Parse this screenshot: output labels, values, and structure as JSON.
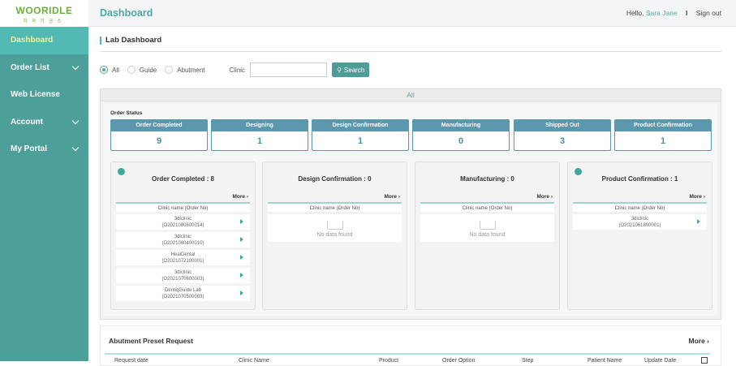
{
  "logo": {
    "name": "WOORIDLE",
    "sub": "치과기공소"
  },
  "sidebar": {
    "items": [
      {
        "label": "Dashboard"
      },
      {
        "label": "Order List"
      },
      {
        "label": "Web License"
      },
      {
        "label": "Account"
      },
      {
        "label": "My Portal"
      }
    ]
  },
  "header": {
    "title": "Dashboard",
    "hello": "Hello,",
    "user": "Sara Jane",
    "separator": "I",
    "signout": "Sign out"
  },
  "page": {
    "title": "Lab Dashboard"
  },
  "filters": {
    "options": [
      "All",
      "Guide",
      "Abutment"
    ],
    "clinic_label": "Clinic",
    "clinic_value": "",
    "search": "Search"
  },
  "panel": {
    "tab": "All",
    "order_status_label": "Order Status",
    "statuses": [
      {
        "label": "Order Completed",
        "count": "9"
      },
      {
        "label": "Designing",
        "count": "1"
      },
      {
        "label": "Design Confirmation",
        "count": "1"
      },
      {
        "label": "Manufacturing",
        "count": "0"
      },
      {
        "label": "Shipped Out",
        "count": "3"
      },
      {
        "label": "Product Confirmation",
        "count": "1"
      }
    ],
    "more": "More",
    "column_header": "Clinic name (Order No)",
    "empty": "No data found",
    "columns": [
      {
        "title": "Order Completed : 8",
        "rows": [
          {
            "clinic": "3diclinic",
            "order": "(O2021080600014)"
          },
          {
            "clinic": "3diclinic",
            "order": "(O2021080400010)"
          },
          {
            "clinic": "HealDental",
            "order": "(O2021072100001)"
          },
          {
            "clinic": "3diclinic",
            "order": "(O2021070600003)"
          },
          {
            "clinic": "DentiqGuide Lab",
            "order": "(O2021070500003)"
          }
        ]
      },
      {
        "title": "Design Confirmation : 0"
      },
      {
        "title": "Manufacturing : 0"
      },
      {
        "title": "Product Confirmation : 1",
        "rows": [
          {
            "clinic": "3diclinic",
            "order": "(O2021061800001)"
          }
        ]
      }
    ]
  },
  "preset": {
    "title": "Abutment Preset Request",
    "more": "More",
    "columns": [
      "Request date",
      "Clinic Name",
      "Product",
      "Order Option",
      "Step",
      "Patient Name",
      "Update Date"
    ]
  }
}
